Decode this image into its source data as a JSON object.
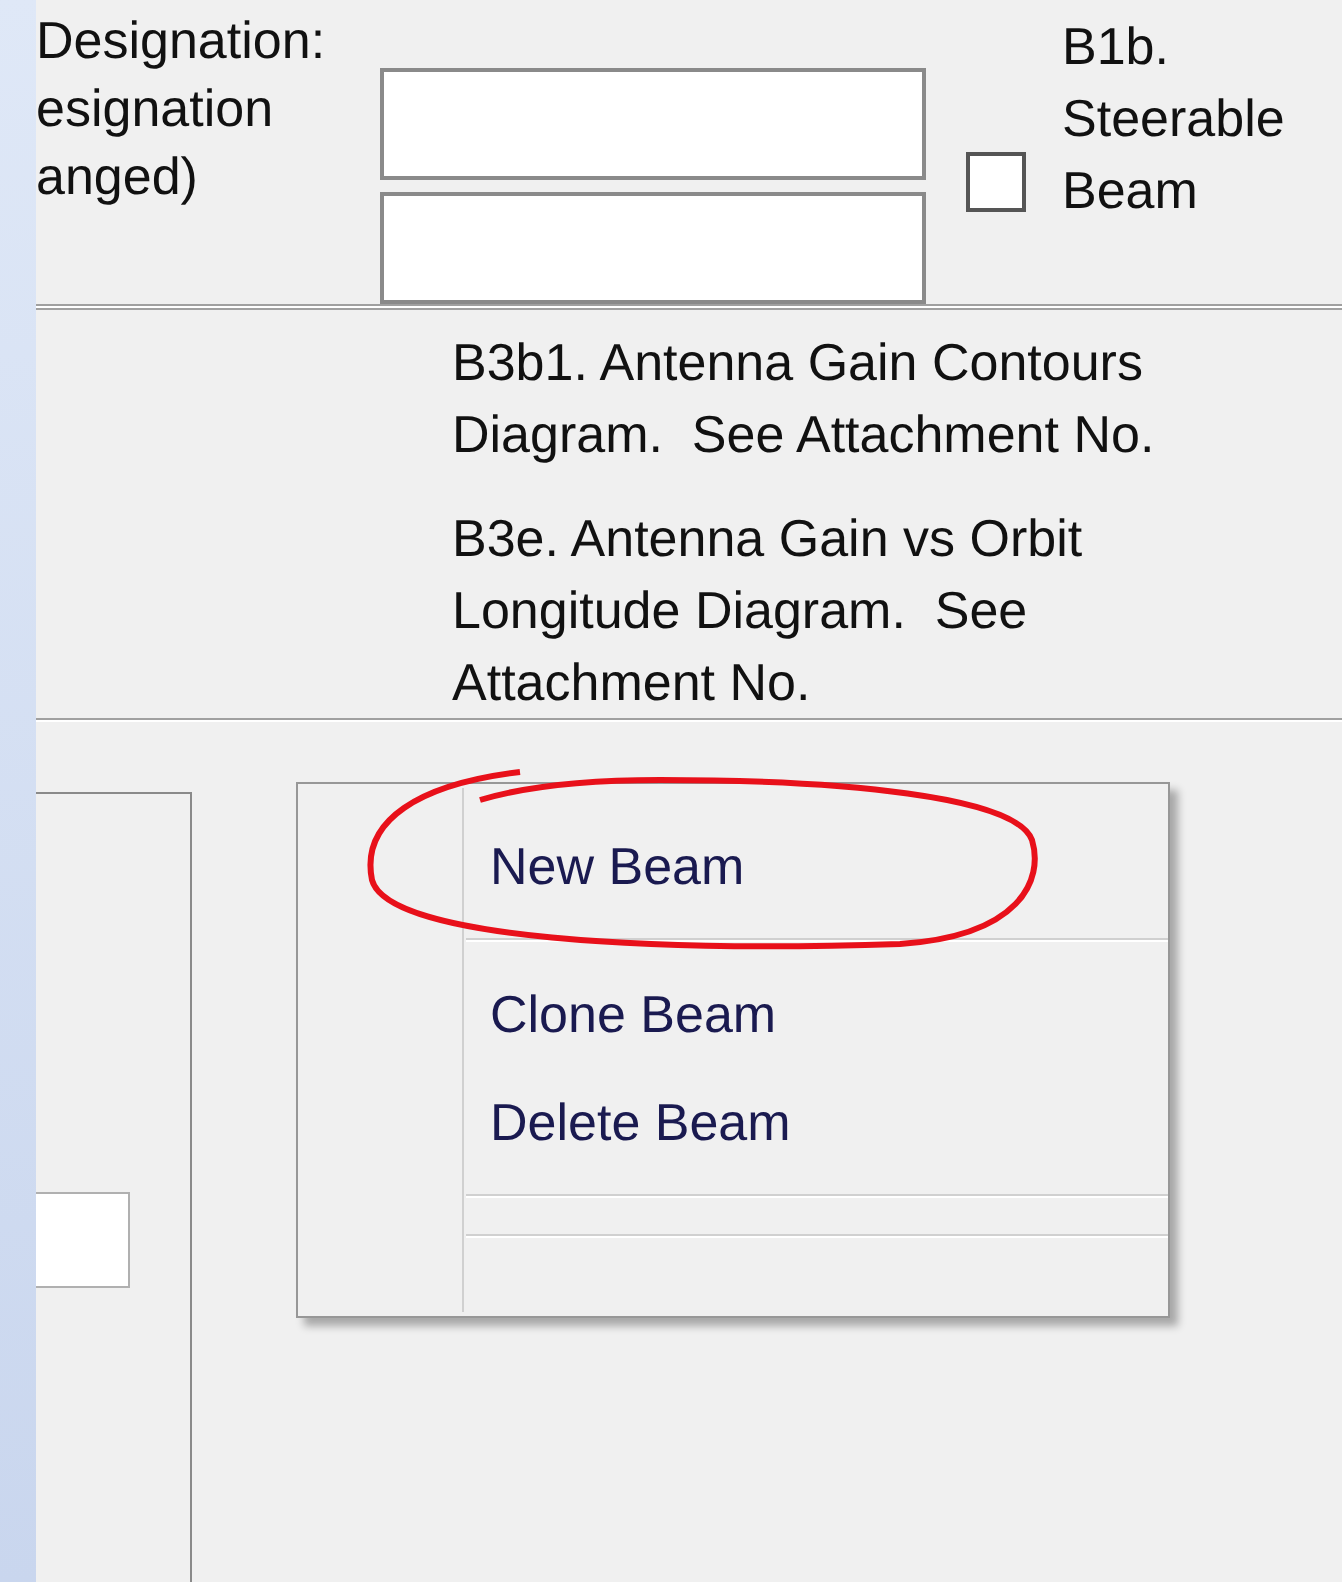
{
  "form": {
    "labels": [
      "Designation:",
      "esignation",
      "anged)"
    ],
    "fields": [
      {
        "kind": "text"
      },
      {
        "kind": "text"
      }
    ],
    "checkbox": {
      "label": "B1b. Steerable Beam",
      "checked": false
    }
  },
  "attachments": [
    "B3b1. Antenna Gain Contours Diagram.  See Attachment No.",
    "B3e. Antenna Gain vs Orbit Longitude Diagram.  See Attachment No."
  ],
  "context_menu": {
    "items": [
      {
        "kind": "item",
        "label": "New Beam",
        "circled": true
      },
      {
        "kind": "separator"
      },
      {
        "kind": "item",
        "label": "Clone Beam",
        "circled": false
      },
      {
        "kind": "item",
        "label": "Delete Beam",
        "circled": false
      },
      {
        "kind": "separator"
      },
      {
        "kind": "separator"
      }
    ]
  }
}
